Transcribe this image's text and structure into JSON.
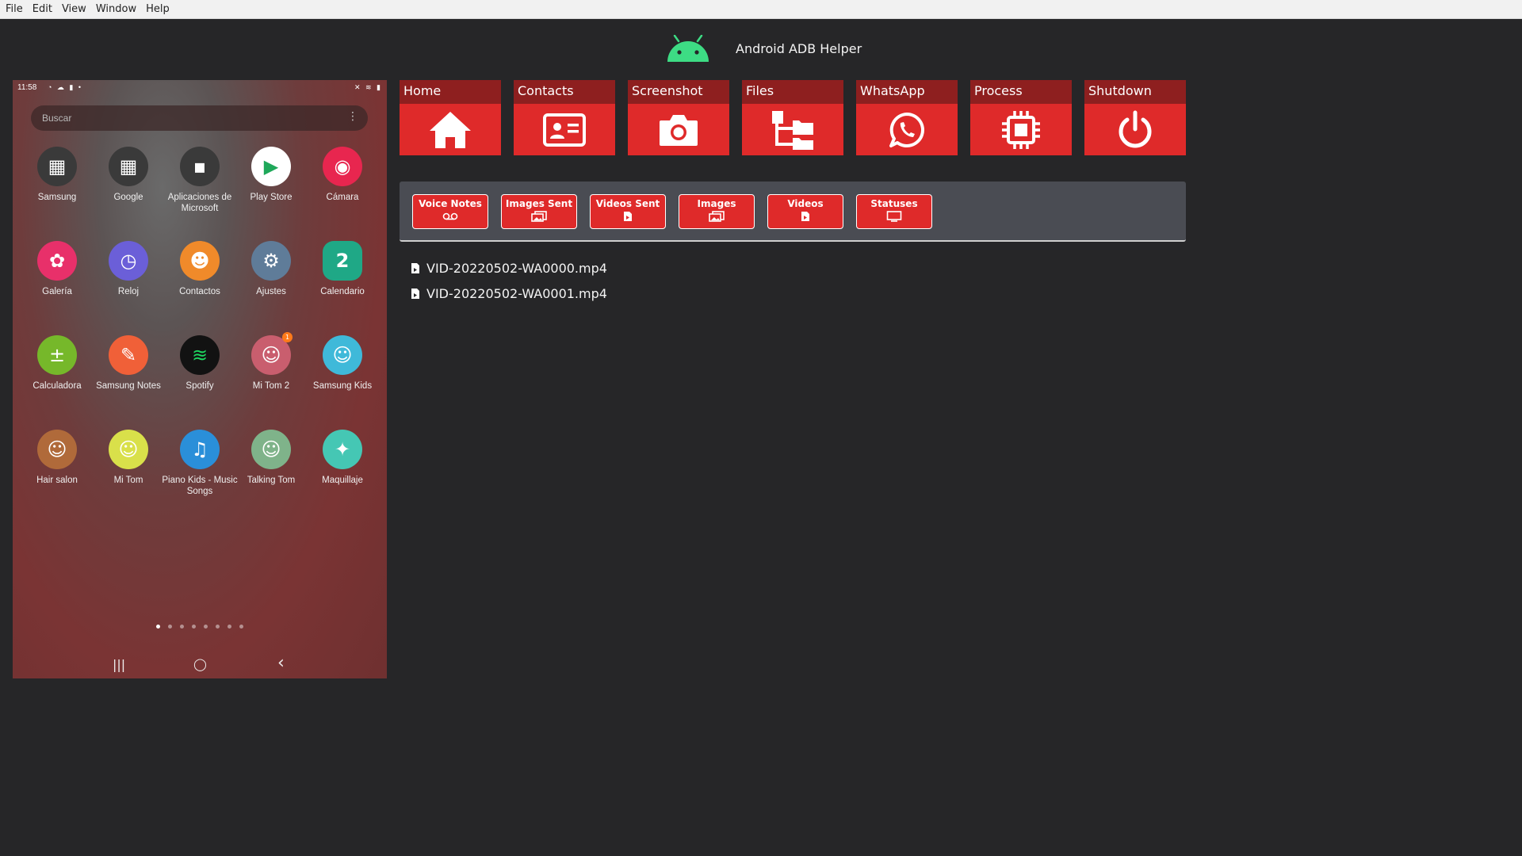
{
  "menu": [
    "File",
    "Edit",
    "View",
    "Window",
    "Help"
  ],
  "app": {
    "title": "Android ADB Helper",
    "logo_icon": "android-icon",
    "accent": "#3ddc84"
  },
  "phone": {
    "time": "11:58",
    "status_left_icons": "◔ ☁ ▮ •",
    "status_right_icons": "✕ ≋ ▮",
    "search_placeholder": "Buscar",
    "search_menu": "⋮",
    "apps": [
      {
        "label": "Samsung",
        "icon": "samsung-folder-icon",
        "color": "#3a3a3a"
      },
      {
        "label": "Google",
        "icon": "google-folder-icon",
        "color": "#3a3a3a"
      },
      {
        "label": "Aplicaciones de Microsoft",
        "icon": "microsoft-folder-icon",
        "color": "#3a3a3a"
      },
      {
        "label": "Play Store",
        "icon": "play-store-icon",
        "color": "#ffffff"
      },
      {
        "label": "Cámara",
        "icon": "camera-app-icon",
        "color": "#e8264f"
      },
      {
        "label": "Galería",
        "icon": "gallery-icon",
        "color": "#e8306a"
      },
      {
        "label": "Reloj",
        "icon": "clock-icon",
        "color": "#6b5fd8"
      },
      {
        "label": "Contactos",
        "icon": "contacts-app-icon",
        "color": "#f08a2a"
      },
      {
        "label": "Ajustes",
        "icon": "settings-icon",
        "color": "#5f7c99"
      },
      {
        "label": "Calendario",
        "icon": "calendar-icon",
        "color": "#1fa886"
      },
      {
        "label": "Calculadora",
        "icon": "calculator-icon",
        "color": "#76b82a"
      },
      {
        "label": "Samsung Notes",
        "icon": "samsung-notes-icon",
        "color": "#f06038"
      },
      {
        "label": "Spotify",
        "icon": "spotify-icon",
        "color": "#121212"
      },
      {
        "label": "Mi Tom 2",
        "icon": "my-tom-2-icon",
        "color": "#c95e6e",
        "badge": "1"
      },
      {
        "label": "Samsung Kids",
        "icon": "samsung-kids-icon",
        "color": "#3fb9d9"
      },
      {
        "label": "Hair salon",
        "icon": "hair-salon-icon",
        "color": "#b06a3a"
      },
      {
        "label": "Mi Tom",
        "icon": "my-tom-icon",
        "color": "#d9e04a"
      },
      {
        "label": "Piano Kids - Music Songs",
        "icon": "piano-kids-icon",
        "color": "#2a8fd9"
      },
      {
        "label": "Talking Tom",
        "icon": "talking-tom-icon",
        "color": "#7fb38a"
      },
      {
        "label": "Maquillaje",
        "icon": "makeup-icon",
        "color": "#45c7b4"
      }
    ],
    "page_dots": 8,
    "active_page": 0,
    "nav": {
      "recent": "|||",
      "home": "◯",
      "back": "‹"
    }
  },
  "tools": [
    {
      "label": "Home",
      "icon": "home-icon"
    },
    {
      "label": "Contacts",
      "icon": "contact-card-icon"
    },
    {
      "label": "Screenshot",
      "icon": "camera-icon"
    },
    {
      "label": "Files",
      "icon": "folder-tree-icon"
    },
    {
      "label": "WhatsApp",
      "icon": "whatsapp-icon"
    },
    {
      "label": "Process",
      "icon": "cpu-chip-icon"
    },
    {
      "label": "Shutdown",
      "icon": "power-icon"
    }
  ],
  "whatsapp_buttons": [
    {
      "label": "Voice Notes",
      "icon": "voicemail-icon"
    },
    {
      "label": "Images Sent",
      "icon": "images-icon"
    },
    {
      "label": "Videos Sent",
      "icon": "video-file-icon"
    },
    {
      "label": "Images",
      "icon": "images-icon"
    },
    {
      "label": "Videos",
      "icon": "video-file-icon"
    },
    {
      "label": "Statuses",
      "icon": "monitor-icon"
    }
  ],
  "files": [
    "VID-20220502-WA0000.mp4",
    "VID-20220502-WA0001.mp4"
  ],
  "colors": {
    "tile_red": "#df2a2a",
    "tile_header": "#8e1f1f",
    "panel": "#4a4c53",
    "background": "#262628"
  }
}
